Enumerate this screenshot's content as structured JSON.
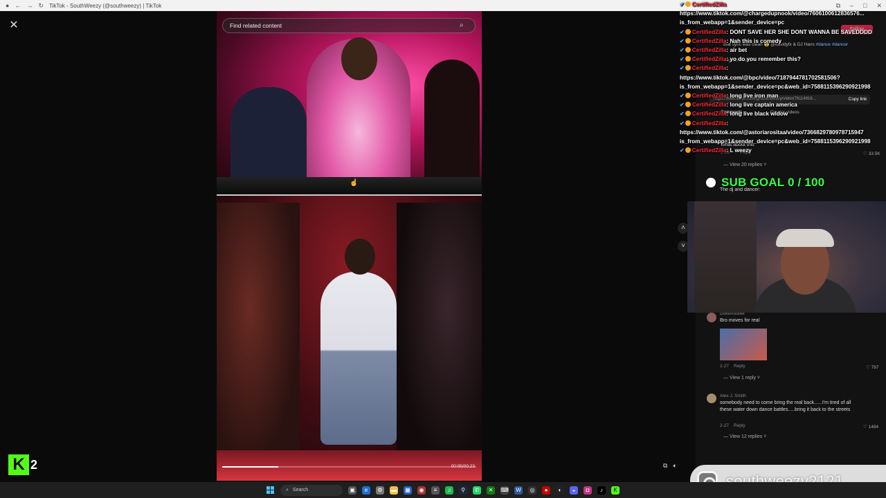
{
  "window": {
    "title": "TikTok - SouthWeezy (@southweezy) | TikTok"
  },
  "video": {
    "search_placeholder": "Find related content",
    "time": "00:05/00:23",
    "progress": 0.22
  },
  "panel": {
    "follow_label": "Follow",
    "link_text": "https://www.tiktok.com/@southweezy/video/76114816...",
    "copy_link": "Copy link",
    "tabs": [
      "Comments",
      "Creator videos"
    ],
    "header_line1": "that sync was clean 😮 @davidyfx & DJ Hans",
    "hashtags": "#dance #dancer",
    "original_sound": "original sound",
    "comment0": {
      "text": "What about this",
      "date": "2-25",
      "reply": "Reply",
      "likes": "33.5K",
      "view": "View 20 replies"
    },
    "comment1": {
      "user": "DukeAttaber",
      "text": "The dj and dancer:"
    },
    "comment2": {
      "user": "DukeAttuber",
      "text": "Bro moves for real",
      "date": "2-27",
      "reply": "Reply",
      "likes": "797",
      "view": "View 1 reply"
    },
    "comment3": {
      "user": "Alex J. Smith",
      "text": "somebody need to come bring the real back......I'm tired of all these water down dance battles.....bring it back to the streets",
      "date": "2-27",
      "reply": "Reply",
      "likes": "1484",
      "view": "View 12 replies"
    }
  },
  "chat": {
    "header_user": "CertifiedZilla",
    "messages": [
      {
        "user": "",
        "text": "https://www.tiktok.com/@chargedupnook/video/7606100612836576..."
      },
      {
        "user": "",
        "text": "is_from_webapp=1&sender_device=pc"
      },
      {
        "user": "CertifiedZilla",
        "text": "DONT SAVE HER SHE DONT WANNA BE SAVEDDDD"
      },
      {
        "user": "CertifiedZilla",
        "text": "Nah this is comedy"
      },
      {
        "user": "CertifiedZilla",
        "text": "air bet"
      },
      {
        "user": "CertifiedZilla",
        "text": "yo do you remember this?"
      },
      {
        "user": "CertifiedZilla",
        "text": ""
      },
      {
        "user": "",
        "text": "https://www.tiktok.com/@bpc/video/7187944781702581506?"
      },
      {
        "user": "",
        "text": "is_from_webapp=1&sender_device=pc&web_id=7588115396290921998"
      },
      {
        "user": "CertifiedZilla",
        "text": "long live iron man"
      },
      {
        "user": "CertifiedZilla",
        "text": "long live captain america"
      },
      {
        "user": "CertifiedZilla",
        "text": "long live black widow"
      },
      {
        "user": "CertifiedZilla",
        "text": ""
      },
      {
        "user": "",
        "text": "https://www.tiktok.com/@astoriarositaa/video/7366829780978715947"
      },
      {
        "user": "",
        "text": "is_from_webapp=1&sender_device=pc&web_id=7588115396290921998"
      },
      {
        "user": "CertifiedZilla",
        "text": "L weezy"
      }
    ]
  },
  "overlay": {
    "sub_goal": "SUB GOAL 0 / 100",
    "kick_count": "2",
    "instagram_handle": "southweezy2121"
  },
  "taskbar": {
    "search_label": "Search"
  },
  "colors": {
    "kick_green": "#53fc18",
    "goal_green": "#35ff44",
    "chat_user_red": "#ff2b3a",
    "tiktok_pink": "#fe2c55"
  }
}
